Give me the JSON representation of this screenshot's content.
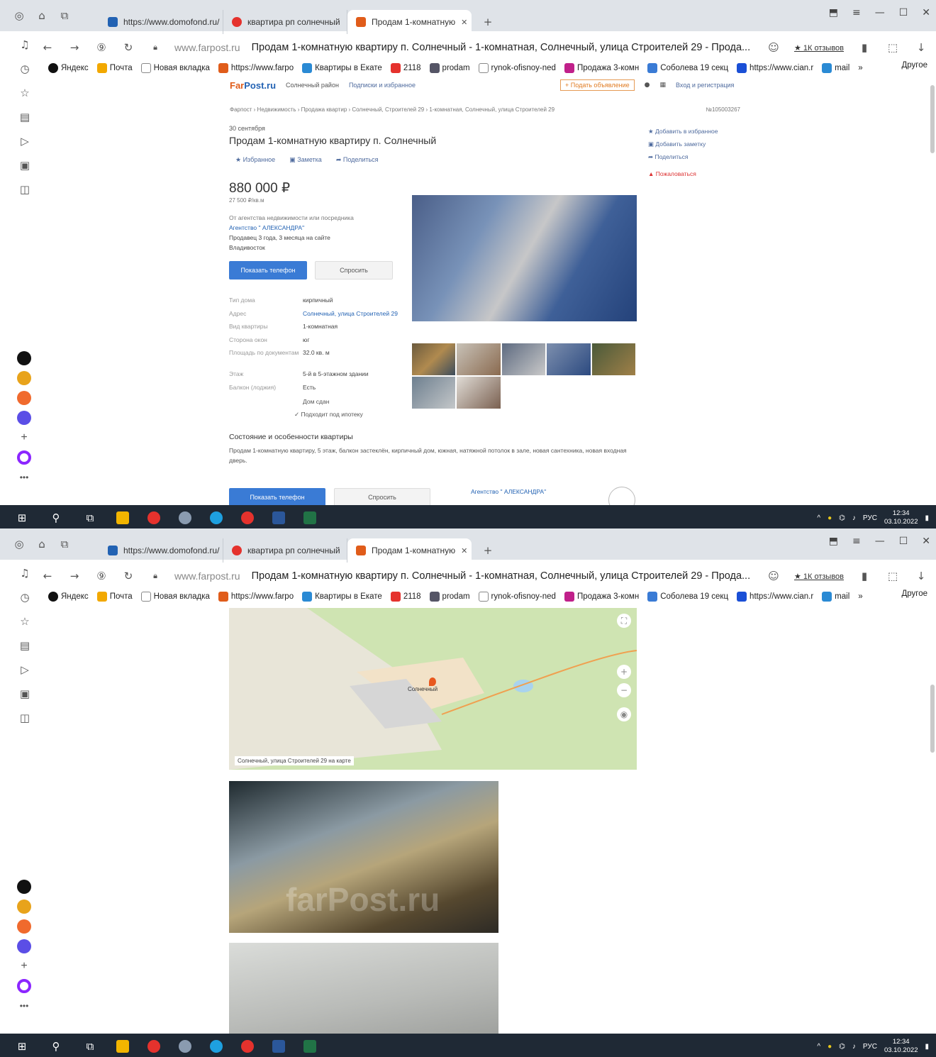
{
  "browser": {
    "tabs": [
      {
        "label": "https://www.domofond.ru/",
        "color": "#2262b3"
      },
      {
        "label": "квартира рп солнечный",
        "color": "#e5322d"
      },
      {
        "label": "Продам 1-комнатную",
        "color": "#e05c1a"
      }
    ],
    "url_host": "www.farpost.ru",
    "page_title": "Продам 1-комнатную квартиру п. Солнечный - 1-комнатная, Солнечный, улица Строителей 29 - Прода...",
    "reviews": "★ 1К отзывов",
    "bookmarks": [
      {
        "label": "Яндекс",
        "color": "#111"
      },
      {
        "label": "Почта",
        "color": "#f2a800"
      },
      {
        "label": "Новая вкладка",
        "color": "#888"
      },
      {
        "label": "https://www.farpo",
        "color": "#e05c1a"
      },
      {
        "label": "Квартиры в Екате",
        "color": "#2a8ad4"
      },
      {
        "label": "2118",
        "color": "#e5322d"
      },
      {
        "label": "prodam",
        "color": "#556"
      },
      {
        "label": "rynok-ofisnoy-ned",
        "color": "#888"
      },
      {
        "label": "Продажа 3-комн",
        "color": "#c0208a"
      },
      {
        "label": "Соболева 19 секц",
        "color": "#3a7bd5"
      },
      {
        "label": "https://www.cian.r",
        "color": "#1a4fd6"
      },
      {
        "label": "mail",
        "color": "#2a8ad4"
      }
    ],
    "bookmarks_more": "»",
    "bookmarks_other": "Другое"
  },
  "site": {
    "logo_a": "Far",
    "logo_b": "Post.ru",
    "region": "Солнечный район",
    "subs": "Подписки и избранное",
    "post_ad": "+ Подать объявление",
    "login": "Вход и регистрация"
  },
  "listing": {
    "breadcrumbs": "Фарпост › Недвижимость › Продажа квартир › Солнечный, Строителей 29 › 1-комнатная, Солнечный, улица Строителей 29",
    "listing_id": "№105003267",
    "date": "30 сентября",
    "title": "Продам 1-комнатную квартиру п. Солнечный",
    "action_fav": "★ Избранное",
    "action_note": "Заметка",
    "action_share": "Поделиться",
    "price": "880 000 ₽",
    "price_per_m": "27 500 ₽/кв.м",
    "seller_type": "От агентства недвижимости или посредника",
    "agency": "Агентство \" АЛЕКСАНДРА\"",
    "seller_since": "Продавец 3 года, 3 месяца на сайте",
    "city": "Владивосток",
    "btn_phone": "Показать телефон",
    "btn_ask": "Спросить",
    "props": [
      {
        "k": "Тип дома",
        "v": "кирпичный",
        "link": false
      },
      {
        "k": "Адрес",
        "v": "Солнечный, улица Строителей 29",
        "link": true
      },
      {
        "k": "Вид квартиры",
        "v": "1-комнатная",
        "link": false
      },
      {
        "k": "Сторона окон",
        "v": "юг",
        "link": false
      },
      {
        "k": "Площадь по документам",
        "v": "32.0 кв. м",
        "link": false
      },
      {
        "k": "Этаж",
        "v": "5-й в 5-этажном здании",
        "link": false
      },
      {
        "k": "Балкон (лоджия)",
        "v": "Есть",
        "link": false
      }
    ],
    "extra_1": "Дом сдан",
    "extra_2": "✓ Подходит под ипотеку",
    "cond_title": "Состояние и особенности квартиры",
    "cond_text": "Продам 1-комнатную квартиру, 5 этаж, балкон застеклён, кирпичный дом, южная, натяжной потолок в зале, новая сантехника, новая входная дверь.",
    "rail_fav": "★ Добавить в избранное",
    "rail_note": "Добавить заметку",
    "rail_share": "Поделиться",
    "rail_report": "Пожаловаться",
    "foot_agency": "Агентство \" АЛЕКСАНДРА\"",
    "map_caption": "Солнечный, улица Строителей 29 на карте",
    "map_town": "Солнечный",
    "watermark": "farPost.ru"
  },
  "taskbar": {
    "lang": "РУС",
    "time": "12:34",
    "date": "03.10.2022"
  }
}
